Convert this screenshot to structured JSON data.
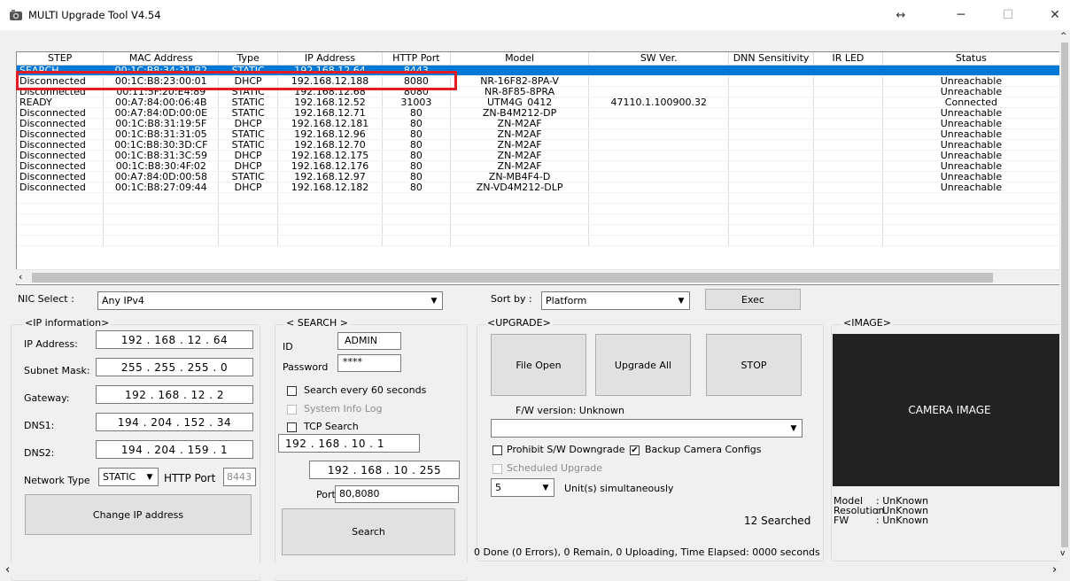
{
  "window": {
    "title": "MULTI Upgrade Tool V4.54"
  },
  "table": {
    "columns": [
      "STEP",
      "MAC Address",
      "Type",
      "IP Address",
      "HTTP Port",
      "Model",
      "SW Ver.",
      "DNN Sensitivity",
      "IR LED",
      "Status"
    ],
    "rows": [
      [
        "SEARCH",
        "00:1C:B8:34:31:B2",
        "STATIC",
        "192.168.12.64",
        "8443",
        "",
        "",
        "",
        "",
        ""
      ],
      [
        "Disconnected",
        "00:1C:B8:23:00:01",
        "DHCP",
        "192.168.12.188",
        "8080",
        "NR-16F82-8PA-V",
        "",
        "",
        "",
        "Unreachable"
      ],
      [
        "Disconnected",
        "00:11:5F:20:E4:89",
        "STATIC",
        "192.168.12.68",
        "8080",
        "NR-8F85-8PRA",
        "",
        "",
        "",
        "Unreachable"
      ],
      [
        "READY",
        "00:A7:84:00:06:4B",
        "STATIC",
        "192.168.12.52",
        "31003",
        "UTM4G_0412",
        "47110.1.100900.32",
        "",
        "",
        "Connected"
      ],
      [
        "Disconnected",
        "00:A7:84:0D:00:0E",
        "STATIC",
        "192.168.12.71",
        "80",
        "ZN-B4M212-DP",
        "",
        "",
        "",
        "Unreachable"
      ],
      [
        "Disconnected",
        "00:1C:B8:31:19:5F",
        "DHCP",
        "192.168.12.181",
        "80",
        "ZN-M2AF",
        "",
        "",
        "",
        "Unreachable"
      ],
      [
        "Disconnected",
        "00:1C:B8:31:31:05",
        "STATIC",
        "192.168.12.96",
        "80",
        "ZN-M2AF",
        "",
        "",
        "",
        "Unreachable"
      ],
      [
        "Disconnected",
        "00:1C:B8:30:3D:CF",
        "STATIC",
        "192.168.12.70",
        "80",
        "ZN-M2AF",
        "",
        "",
        "",
        "Unreachable"
      ],
      [
        "Disconnected",
        "00:1C:B8:31:3C:59",
        "DHCP",
        "192.168.12.175",
        "80",
        "ZN-M2AF",
        "",
        "",
        "",
        "Unreachable"
      ],
      [
        "Disconnected",
        "00:1C:B8:30:4F:02",
        "DHCP",
        "192.168.12.176",
        "80",
        "ZN-M2AF",
        "",
        "",
        "",
        "Unreachable"
      ],
      [
        "Disconnected",
        "00:A7:84:0D:00:58",
        "STATIC",
        "192.168.12.97",
        "80",
        "ZN-MB4F4-D",
        "",
        "",
        "",
        "Unreachable"
      ],
      [
        "Disconnected",
        "00:1C:B8:27:09:44",
        "DHCP",
        "192.168.12.182",
        "80",
        "ZN-VD4M212-DLP",
        "",
        "",
        "",
        "Unreachable"
      ]
    ],
    "empty_rows": 5
  },
  "nic": {
    "label": "NIC Select :",
    "value": "Any IPv4"
  },
  "sort": {
    "label": "Sort by :",
    "value": "Platform",
    "exec": "Exec"
  },
  "ipinfo": {
    "title": "<IP information>",
    "ip_label": "IP Address:",
    "ip": "192 . 168 . 12 . 64",
    "subnet_label": "Subnet Mask:",
    "subnet": "255 . 255 . 255 . 0",
    "gateway_label": "Gateway:",
    "gateway": "192 . 168 . 12 . 2",
    "dns1_label": "DNS1:",
    "dns1": "194 . 204 . 152 . 34",
    "dns2_label": "DNS2:",
    "dns2": "194 . 204 . 159 . 1",
    "nettype_label": "Network Type",
    "nettype": "STATIC",
    "port_label": "HTTP Port",
    "port": "8443",
    "change_btn": "Change IP address"
  },
  "search": {
    "title": "< SEARCH >",
    "id_label": "ID",
    "id": "ADMIN",
    "pw_label": "Password",
    "pw": "****",
    "every": "Search every 60 seconds",
    "syslog": "System Info Log",
    "tcp": "TCP Search",
    "ip_start": "192 . 168 . 10 . 1",
    "ip_end": "192 . 168 . 10 . 255",
    "port_label": "Port",
    "port": "80,8080",
    "btn": "Search"
  },
  "upgrade": {
    "title": "<UPGRADE>",
    "file_open": "File Open",
    "upgrade_all": "Upgrade All",
    "stop": "STOP",
    "fw_version": "F/W version: Unknown",
    "prohibit": "Prohibit S/W Downgrade",
    "backup": "Backup Camera Configs",
    "scheduled": "Scheduled Upgrade",
    "units_value": "5",
    "units_label": "Unit(s) simultaneously",
    "searched": "12 Searched",
    "status": "0 Done (0 Errors), 0 Remain, 0 Uploading, Time Elapsed: 0000 seconds"
  },
  "image": {
    "title": "<IMAGE>",
    "camera": "CAMERA IMAGE",
    "model_label": "Model",
    "model": ": UnKnown",
    "res_label": "Resolution",
    "res": ": UnKnown",
    "fw_label": "FW",
    "fw": ": UnKnown"
  },
  "colors": {
    "selection": "#0078d7",
    "highlight": "#e31b23"
  }
}
